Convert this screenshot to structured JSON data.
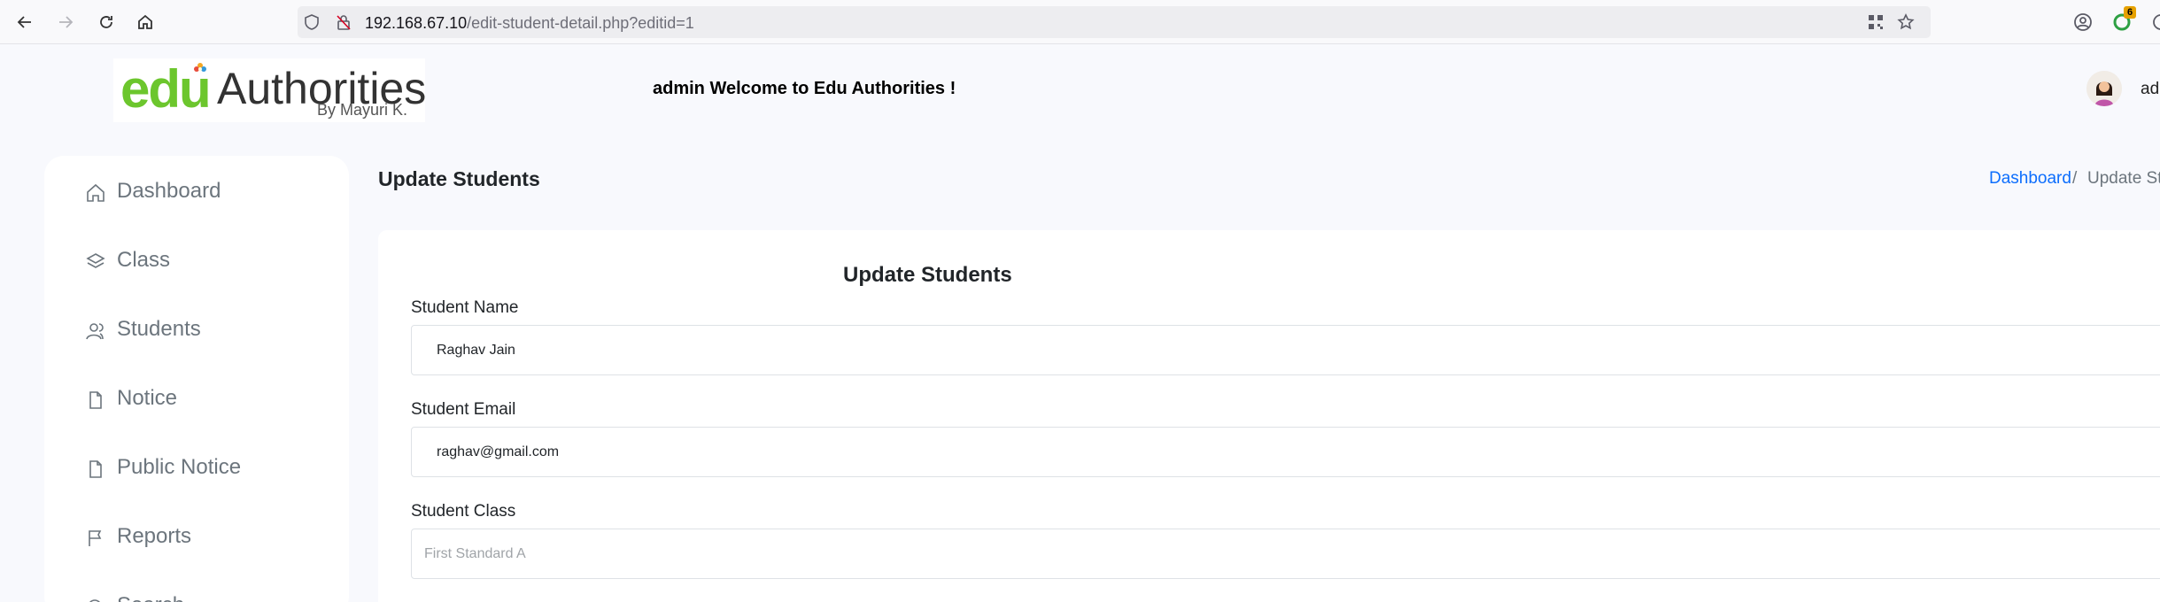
{
  "browser": {
    "url_host": "192.168.67.10",
    "url_path": "/edit-student-detail.php?editid=1",
    "extension_badge": "6"
  },
  "header": {
    "logo_edu": "edu",
    "logo_authorities": "Authorities",
    "logo_byline": "By Mayuri K.",
    "welcome": "admin Welcome to Edu Authorities !",
    "user_name": "admin"
  },
  "sidebar": {
    "items": [
      {
        "label": "Dashboard",
        "icon": "home-icon"
      },
      {
        "label": "Class",
        "icon": "layers-icon"
      },
      {
        "label": "Students",
        "icon": "users-icon"
      },
      {
        "label": "Notice",
        "icon": "file-icon"
      },
      {
        "label": "Public Notice",
        "icon": "file-icon"
      },
      {
        "label": "Reports",
        "icon": "flag-icon"
      },
      {
        "label": "Search",
        "icon": "search-icon"
      }
    ]
  },
  "page": {
    "title": "Update Students",
    "breadcrumb_home": "Dashboard",
    "breadcrumb_separator": "/",
    "breadcrumb_current": "Update Students"
  },
  "form": {
    "title": "Update Students",
    "student_name_label": "Student Name",
    "student_name_value": "Raghav Jain",
    "student_email_label": "Student Email",
    "student_email_value": "raghav@gmail.com",
    "student_class_label": "Student Class",
    "student_class_value": "First Standard A"
  },
  "colors": {
    "page_bg": "#f8f9fd",
    "logo_green": "#6cc62d",
    "link_blue": "#0d6efd",
    "sidebar_text": "#6c757d"
  }
}
